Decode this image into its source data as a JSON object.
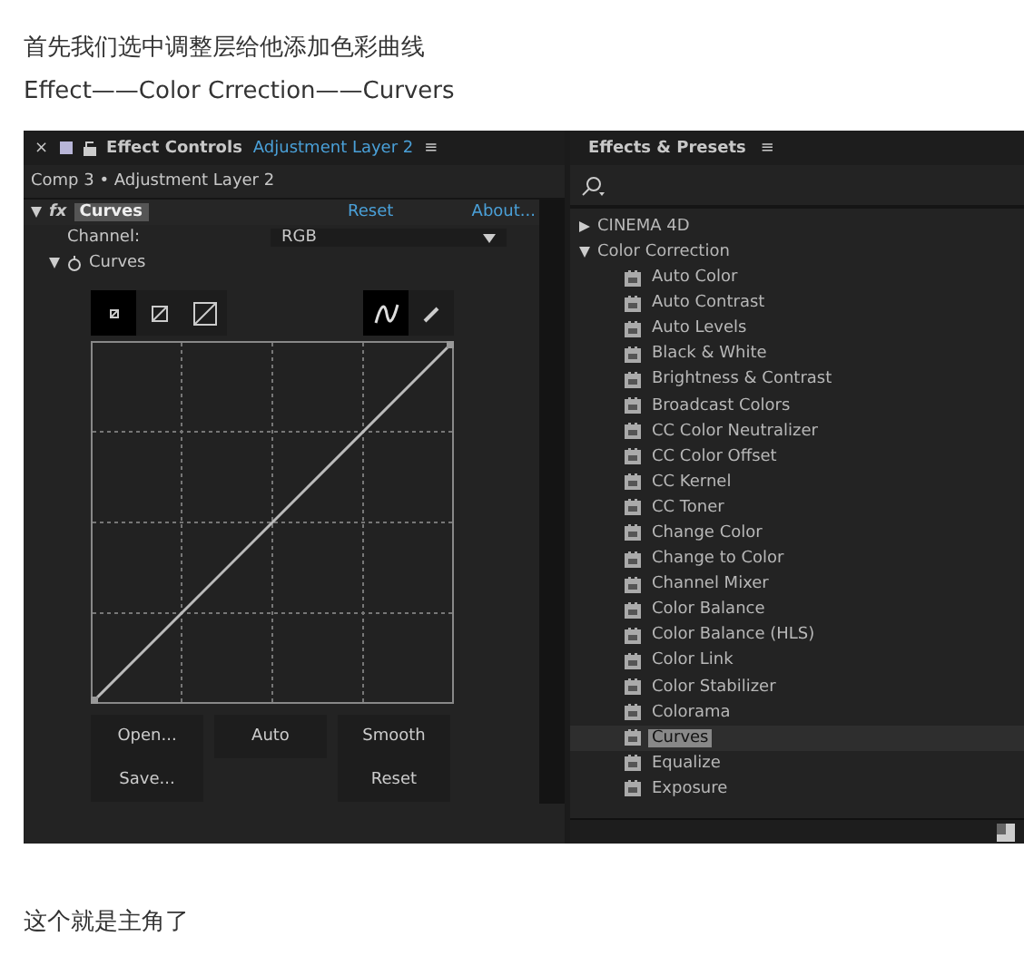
{
  "intro": [
    "首先我们选中调整层给他添加色彩曲线",
    "Effect——Color Crrection——Curvers"
  ],
  "effect_controls": {
    "close": "×",
    "title": "Effect Controls",
    "layer": "Adjustment Layer 2",
    "menu": "≡",
    "breadcrumb": "Comp 3 • Adjustment Layer 2",
    "effect": {
      "fx": "fx",
      "name": "Curves",
      "expanded": true,
      "reset": "Reset",
      "about": "About..."
    },
    "channel": {
      "label": "Channel:",
      "value": "RGB"
    },
    "curves": {
      "label": "Curves",
      "expanded": true
    },
    "view_tools": [
      {
        "kind": "small",
        "selected": true
      },
      {
        "kind": "medium",
        "selected": false
      },
      {
        "kind": "large",
        "selected": false
      }
    ],
    "draw_tools": [
      {
        "kind": "curve",
        "selected": true
      },
      {
        "kind": "pencil",
        "selected": false
      }
    ],
    "buttons": [
      [
        "Open...",
        "Save..."
      ],
      [
        "Auto"
      ],
      [
        "Smooth",
        "Reset"
      ]
    ]
  },
  "effects_presets": {
    "title": "Effects & Presets",
    "menu": "≡",
    "categories": [
      {
        "label": "CINEMA 4D",
        "expanded": false
      },
      {
        "label": "Color Correction",
        "expanded": true,
        "children": [
          {
            "label": "Auto Color",
            "selected": false
          },
          {
            "label": "Auto Contrast",
            "selected": false
          },
          {
            "label": "Auto Levels",
            "selected": false
          },
          {
            "label": "Black & White",
            "selected": false
          },
          {
            "label": "Brightness & Contrast",
            "selected": false
          },
          {
            "label": "Broadcast Colors",
            "selected": false
          },
          {
            "label": "CC Color Neutralizer",
            "selected": false
          },
          {
            "label": "CC Color Offset",
            "selected": false
          },
          {
            "label": "CC Kernel",
            "selected": false
          },
          {
            "label": "CC Toner",
            "selected": false
          },
          {
            "label": "Change Color",
            "selected": false
          },
          {
            "label": "Change to Color",
            "selected": false
          },
          {
            "label": "Channel Mixer",
            "selected": false
          },
          {
            "label": "Color Balance",
            "selected": false
          },
          {
            "label": "Color Balance (HLS)",
            "selected": false
          },
          {
            "label": "Color Link",
            "selected": false
          },
          {
            "label": "Color Stabilizer",
            "selected": false
          },
          {
            "label": "Colorama",
            "selected": false
          },
          {
            "label": "Curves",
            "selected": true
          },
          {
            "label": "Equalize",
            "selected": false
          },
          {
            "label": "Exposure",
            "selected": false
          }
        ]
      }
    ]
  },
  "outro": "这个就是主角了"
}
